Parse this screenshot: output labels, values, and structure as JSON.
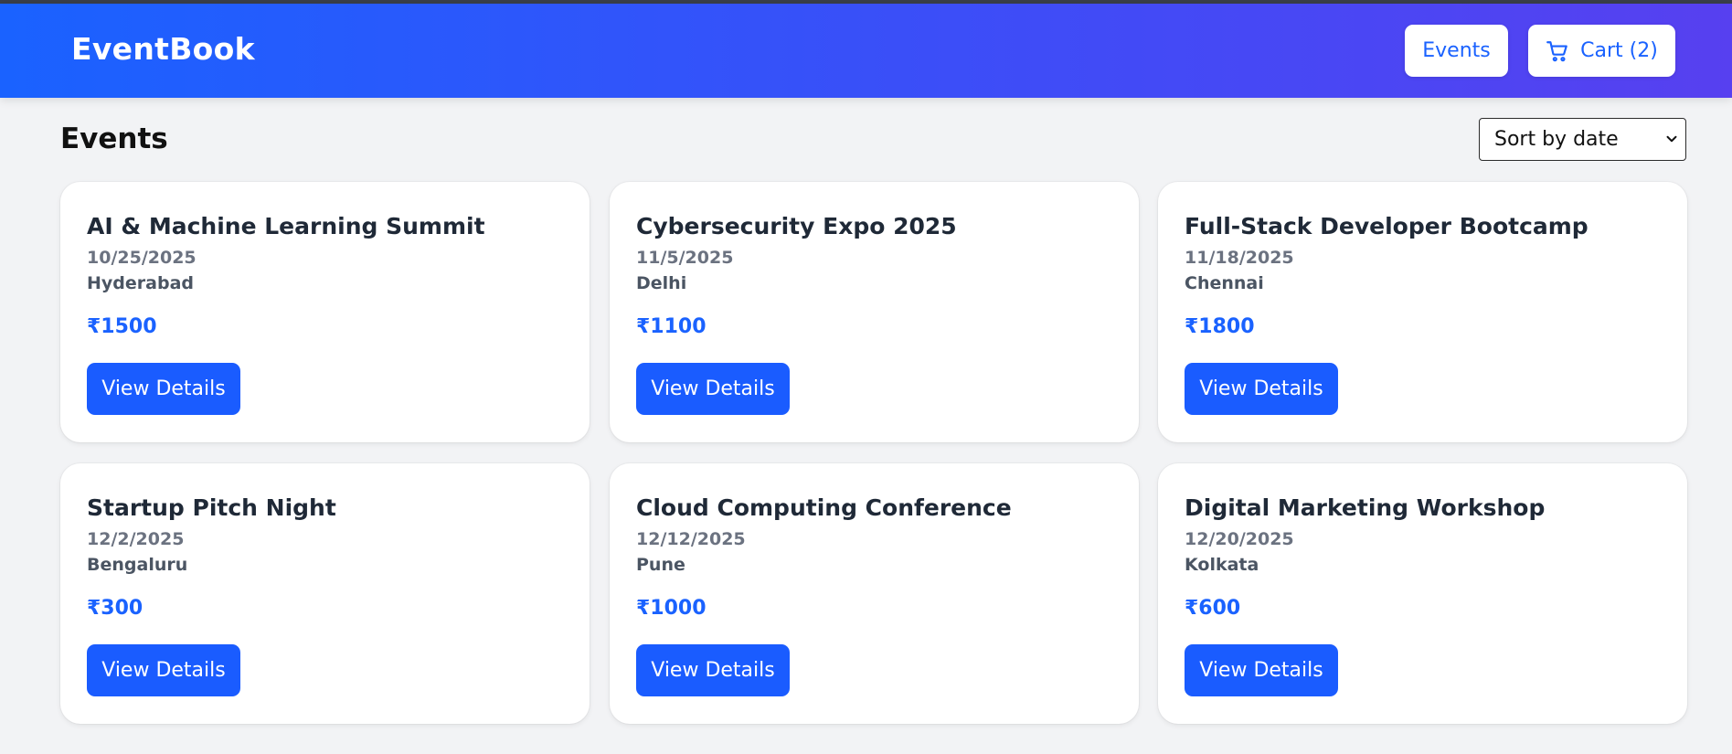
{
  "header": {
    "brand": "EventBook",
    "nav_events": "Events",
    "nav_cart": "Cart (2)",
    "cart_icon": "shopping-cart-icon"
  },
  "main": {
    "title": "Events",
    "sort": {
      "selected": "Sort by date"
    },
    "events": [
      {
        "title": "AI & Machine Learning Summit",
        "date": "10/25/2025",
        "city": "Hyderabad",
        "price": "₹1500",
        "button": "View Details"
      },
      {
        "title": "Cybersecurity Expo 2025",
        "date": "11/5/2025",
        "city": "Delhi",
        "price": "₹1100",
        "button": "View Details"
      },
      {
        "title": "Full-Stack Developer Bootcamp",
        "date": "11/18/2025",
        "city": "Chennai",
        "price": "₹1800",
        "button": "View Details"
      },
      {
        "title": "Startup Pitch Night",
        "date": "12/2/2025",
        "city": "Bengaluru",
        "price": "₹300",
        "button": "View Details"
      },
      {
        "title": "Cloud Computing Conference",
        "date": "12/12/2025",
        "city": "Pune",
        "price": "₹1000",
        "button": "View Details"
      },
      {
        "title": "Digital Marketing Workshop",
        "date": "12/20/2025",
        "city": "Kolkata",
        "price": "₹600",
        "button": "View Details"
      }
    ]
  },
  "colors": {
    "accent": "#1a62ff",
    "header_gradient_start": "#1a62ff",
    "header_gradient_end": "#5740f0",
    "page_background": "#f2f3f5"
  }
}
